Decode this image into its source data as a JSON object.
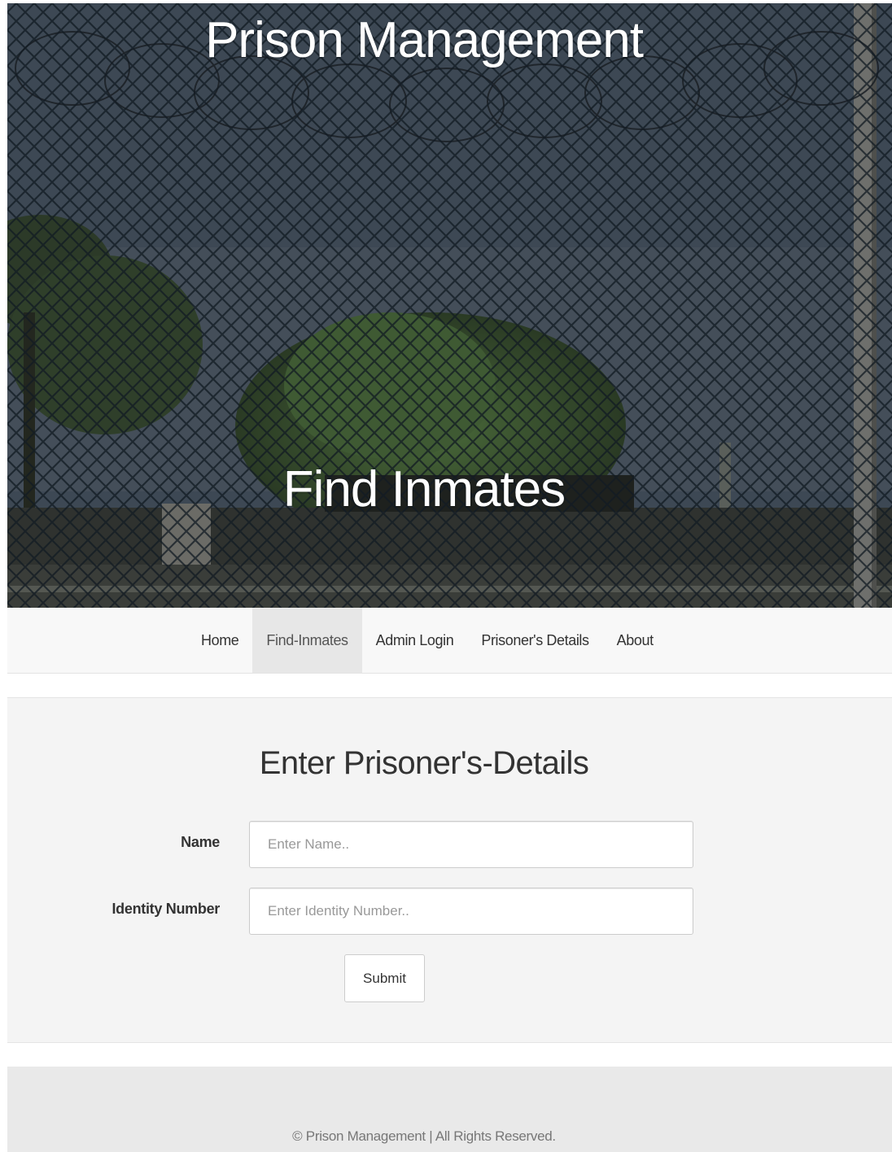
{
  "hero": {
    "title": "Prison Management",
    "subtitle": "Find Inmates"
  },
  "nav": {
    "items": [
      {
        "label": "Home",
        "active": false
      },
      {
        "label": "Find-Inmates",
        "active": true
      },
      {
        "label": "Admin Login",
        "active": false
      },
      {
        "label": "Prisoner's Details",
        "active": false
      },
      {
        "label": "About",
        "active": false
      }
    ]
  },
  "form": {
    "heading": "Enter Prisoner's-Details",
    "name_label": "Name",
    "name_placeholder": "Enter Name..",
    "name_value": "",
    "id_label": "Identity Number",
    "id_placeholder": "Enter Identity Number..",
    "id_value": "",
    "submit_label": "Submit"
  },
  "footer": {
    "text": "© Prison Management | All Rights Reserved."
  }
}
